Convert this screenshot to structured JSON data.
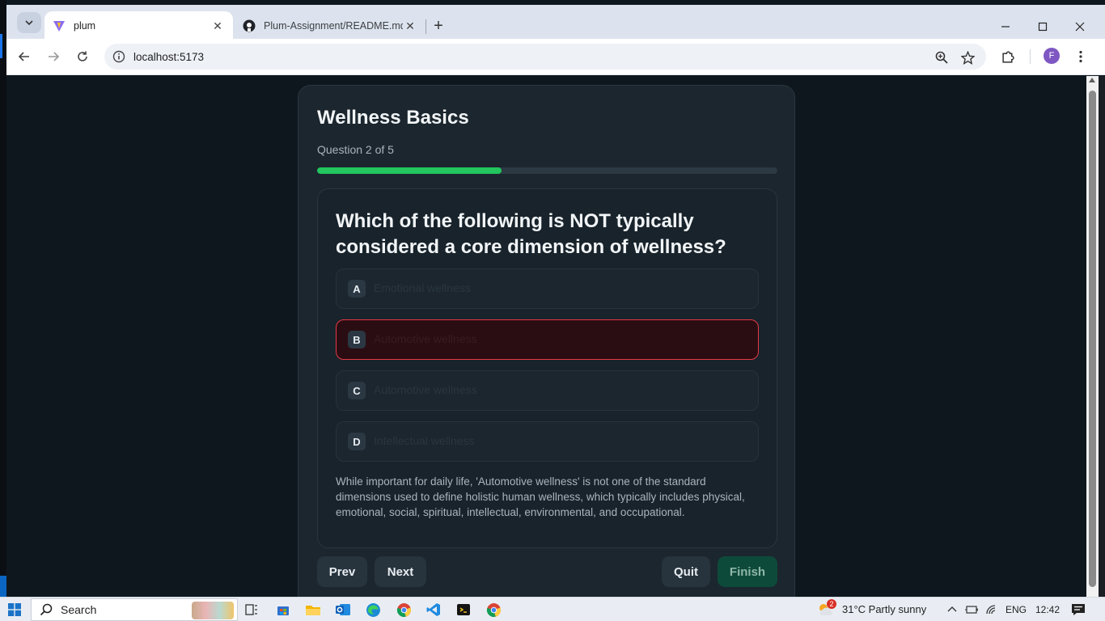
{
  "browser": {
    "tabs": [
      {
        "title": "plum",
        "active": true
      },
      {
        "title": "Plum-Assignment/README.md",
        "active": false
      }
    ],
    "url": "localhost:5173",
    "profile_initial": "F"
  },
  "quiz": {
    "title": "Wellness Basics",
    "counter": "Question 2 of 5",
    "progress_fraction": 0.4,
    "question": "Which of the following is NOT typically considered a core dimension of wellness?",
    "options": [
      {
        "letter": "A",
        "text": "Emotional wellness",
        "selected": false
      },
      {
        "letter": "B",
        "text": "Automotive wellness",
        "selected": true
      },
      {
        "letter": "C",
        "text": "Automotive wellness",
        "selected": false
      },
      {
        "letter": "D",
        "text": "Intellectual wellness",
        "selected": false
      }
    ],
    "explanation": "While important for daily life, 'Automotive wellness' is not one of the standard dimensions used to define holistic human wellness, which typically includes physical, emotional, social, spiritual, intellectual, environmental, and occupational.",
    "buttons": {
      "prev": "Prev",
      "next": "Next",
      "quit": "Quit",
      "finish": "Finish"
    }
  },
  "taskbar": {
    "search_label": "Search",
    "weather_badge": "2",
    "weather": "31°C  Partly sunny",
    "language": "ENG",
    "time": "12:42"
  },
  "colors": {
    "progress": "#22c55e",
    "selected_border": "#e53945",
    "page_bg": "#0f171e",
    "finish_bg": "#0e4a3a"
  }
}
